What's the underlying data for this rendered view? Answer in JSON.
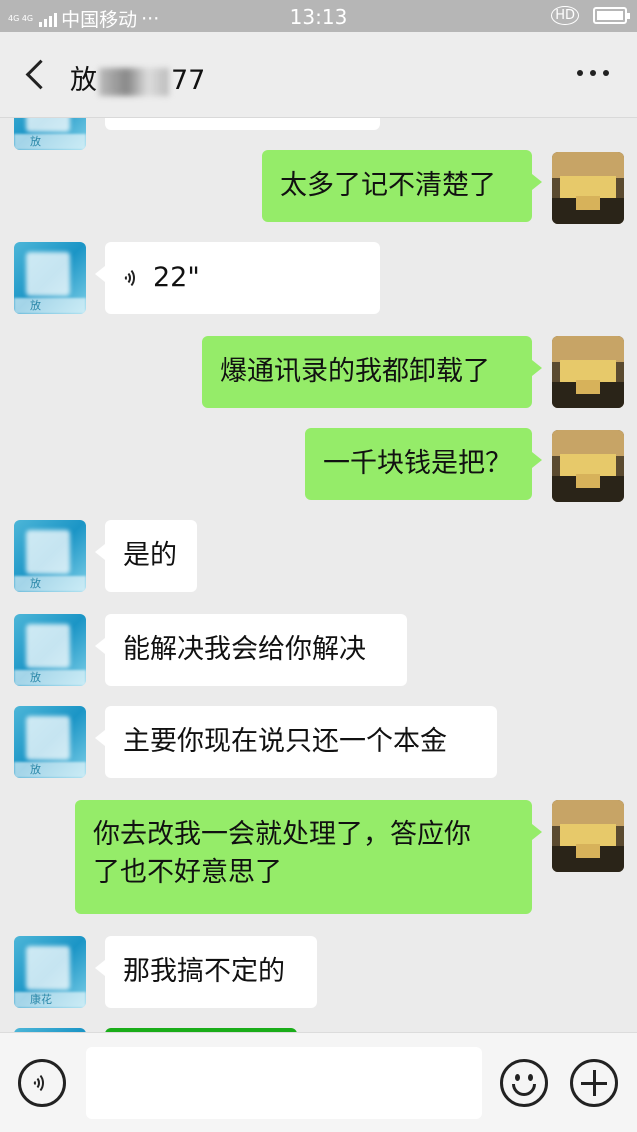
{
  "status_bar": {
    "network_small": "4G 4G",
    "carrier": "中国移动",
    "dots": "···",
    "time": "13:13",
    "hd_label": "HD"
  },
  "header": {
    "title_prefix": "放",
    "title_suffix": "77",
    "back_icon": "chevron-left-icon",
    "more_icon": "more-dots-icon"
  },
  "contact": {
    "avatar_label_1": "放",
    "avatar_label_2": "放",
    "avatar_label_3": "放",
    "avatar_label_4": "放",
    "avatar_label_5": "康花"
  },
  "messages": [
    {
      "side": "right",
      "text": "太多了记不清楚了"
    },
    {
      "side": "left",
      "type": "voice",
      "duration": "22\""
    },
    {
      "side": "right",
      "text": "爆通讯录的我都卸载了"
    },
    {
      "side": "right",
      "text": "一千块钱是把？"
    },
    {
      "side": "left",
      "text": "是的"
    },
    {
      "side": "left",
      "text": "能解决我会给你解决"
    },
    {
      "side": "left",
      "text": "主要你现在说只还一个本金"
    },
    {
      "side": "right",
      "text_line1": "你去改我一会就处理了，答应你",
      "text_line2": "了也不好意思了"
    },
    {
      "side": "left",
      "text": "那我搞不定的"
    }
  ],
  "input_bar": {
    "voice_icon": "voice-input-icon",
    "emoji_icon": "smile-icon",
    "plus_icon": "plus-icon",
    "text_value": ""
  },
  "colors": {
    "chat_bg": "#ebebeb",
    "my_bubble": "#95ec69",
    "their_bubble": "#ffffff",
    "status_bar": "#b6b6b6"
  }
}
